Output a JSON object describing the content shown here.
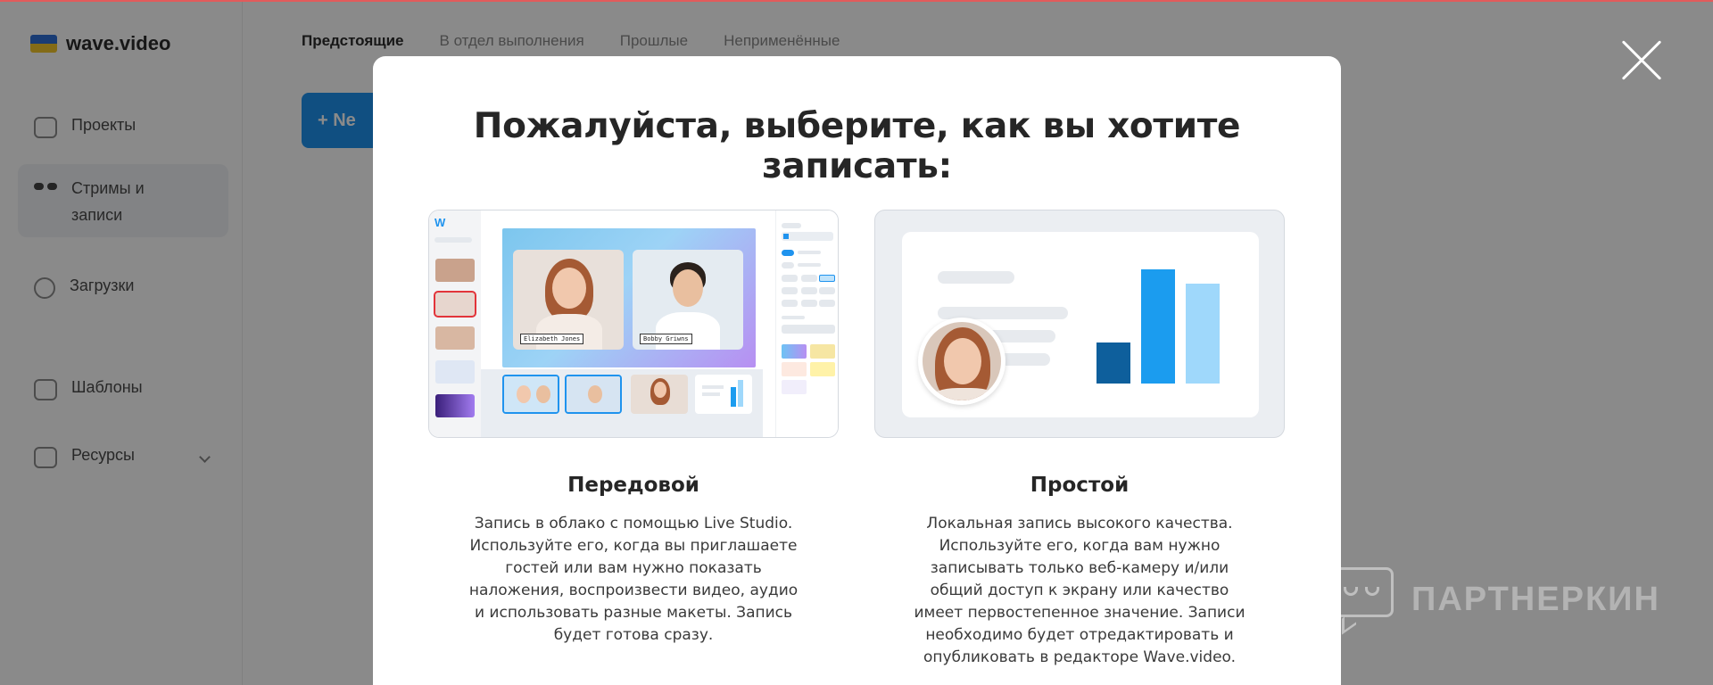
{
  "app": {
    "logo_text": "wave.video",
    "sidebar": {
      "items": [
        {
          "label": "Проекты"
        },
        {
          "label": "Стримы и записи"
        },
        {
          "label": "Загрузки"
        },
        {
          "label": "Шаблоны"
        },
        {
          "label": "Ресурсы"
        }
      ]
    },
    "tabs": [
      "Предстоящие",
      "В отдел выполнения",
      "Прошлые",
      "Неприменённые"
    ],
    "create_button": "+ Ne"
  },
  "modal": {
    "title": "Пожалуйста, выберите, как вы хотите записать:",
    "advanced": {
      "title": "Передовой",
      "description": "Запись в облако с помощью Live Studio. Используйте его, когда вы приглашаете гостей или вам нужно показать наложения, воспроизвести видео, аудио и использовать разные макеты. Запись будет готова сразу.",
      "preview": {
        "logo": "W",
        "name_tag_1": "Elizabeth Jones",
        "name_tag_2": "Bobby Griwns"
      }
    },
    "simple": {
      "title": "Простой",
      "description": "Локальная запись высокого качества. Используйте его, когда вам нужно записывать только веб-камеру и/или общий доступ к экрану или качество имеет первостепенное значение. Записи необходимо будет отредактировать и опубликовать в редакторе Wave.video.",
      "preview": {
        "bar_colors": [
          "#0e5f9c",
          "#1b9cef",
          "#9fd8fb"
        ]
      }
    },
    "close_icon": "close-icon"
  },
  "watermark": {
    "text": "ПАРТНЕРКИН"
  }
}
